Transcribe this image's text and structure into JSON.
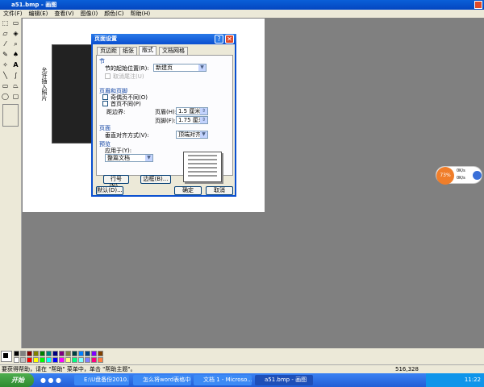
{
  "window": {
    "title": "a51.bmp - 画图"
  },
  "menu": [
    "文件(F)",
    "编辑(E)",
    "查看(V)",
    "图像(I)",
    "颜色(C)",
    "帮助(H)"
  ],
  "canvas": {
    "vertical_text": "允许插入照片"
  },
  "dialog": {
    "title": "页面设置",
    "tabs": [
      "页边距",
      "纸张",
      "版式",
      "文档网格"
    ],
    "active_tab": "版式",
    "section_label": "节",
    "section_start_label": "节的起始位置(R):",
    "section_start_value": "新建页",
    "suppress_endnotes": "取消尾注(U)",
    "header_footer_label": "页眉和页脚",
    "odd_even": "奇偶页不同(O)",
    "first_page": "首页不同(P)",
    "from_edge": "距边界:",
    "header_label": "页眉(H):",
    "header_value": "1.5 厘米",
    "footer_label": "页脚(F):",
    "footer_value": "1.75 厘米",
    "page_label": "页面",
    "valign_label": "垂直对齐方式(V):",
    "valign_value": "顶端对齐",
    "preview_label": "预览",
    "apply_to_label": "应用于(Y):",
    "apply_to_value": "整篇文档",
    "line_numbers": "行号(N)...",
    "borders": "边框(B)...",
    "default": "默认(D)...",
    "ok": "确定",
    "cancel": "取消"
  },
  "palette": {
    "top": [
      "#000000",
      "#808080",
      "#800000",
      "#808000",
      "#008000",
      "#008080",
      "#000080",
      "#800080",
      "#808040",
      "#004040",
      "#0080ff",
      "#004080",
      "#8000ff",
      "#804000"
    ],
    "bottom": [
      "#ffffff",
      "#c0c0c0",
      "#ff0000",
      "#ffff00",
      "#00ff00",
      "#00ffff",
      "#0000ff",
      "#ff00ff",
      "#ffff80",
      "#00ff80",
      "#80ffff",
      "#8080ff",
      "#ff0080",
      "#ff8040"
    ]
  },
  "status": {
    "help": "要获得帮助，请在 \"帮助\" 菜单中，单击 \"帮助主题\"。",
    "coords": "516,328"
  },
  "taskbar": {
    "start": "开始",
    "tasks": [
      "E:\\U盘备份2010.1...",
      "怎么将word表格中...",
      "文档 1 - Microso...",
      "a51.bmp - 画图"
    ],
    "clock": "11:22"
  },
  "netmon": {
    "percent": "73%",
    "up": "0K/s",
    "down": "0K/s"
  }
}
